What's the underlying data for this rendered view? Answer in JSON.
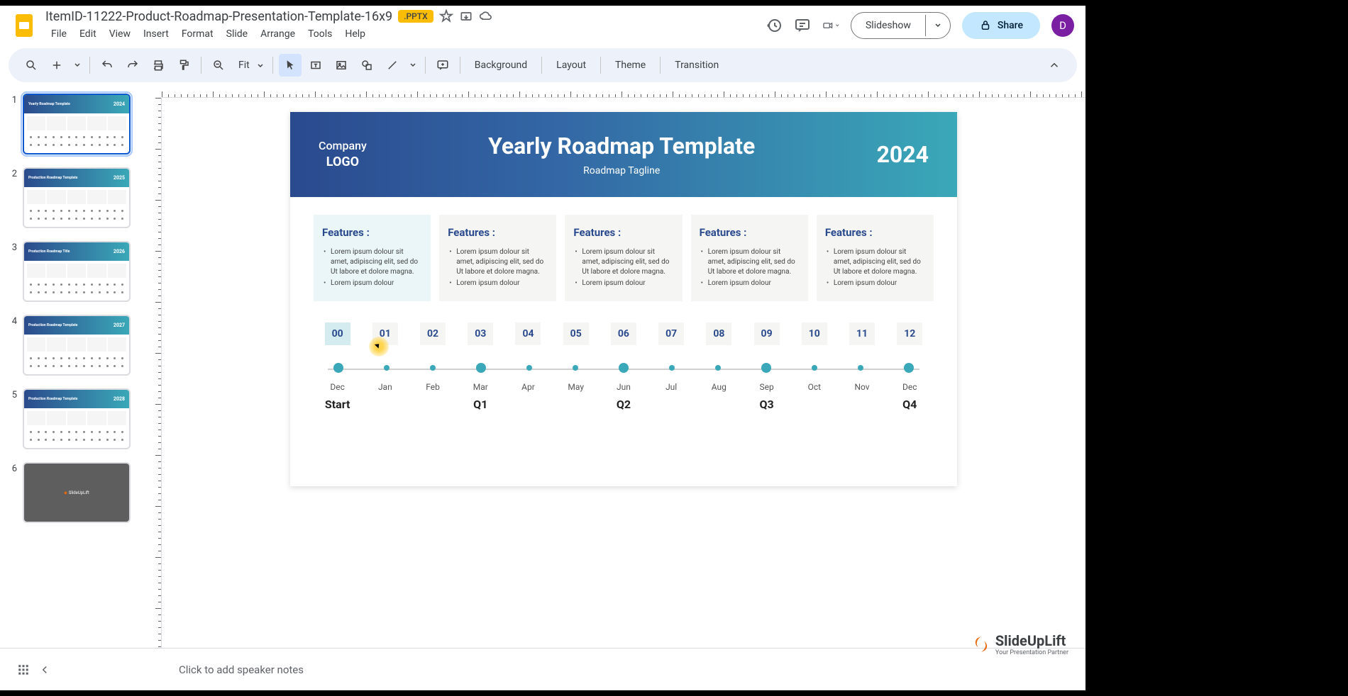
{
  "doc": {
    "title": "ItemID-11222-Product-Roadmap-Presentation-Template-16x9",
    "badge": ".PPTX"
  },
  "menus": [
    "File",
    "Edit",
    "View",
    "Insert",
    "Format",
    "Slide",
    "Arrange",
    "Tools",
    "Help"
  ],
  "toolbar": {
    "zoom": "Fit",
    "background": "Background",
    "layout": "Layout",
    "theme": "Theme",
    "transition": "Transition"
  },
  "header_actions": {
    "slideshow": "Slideshow",
    "share": "Share",
    "avatar": "D"
  },
  "thumbnails": [
    {
      "num": "1",
      "title": "Yearly Roadmap Template",
      "year": "2024",
      "selected": true
    },
    {
      "num": "2",
      "title": "Production Roadmap Template",
      "year": "2025",
      "selected": false
    },
    {
      "num": "3",
      "title": "Production Roadmap Title",
      "year": "2026",
      "selected": false
    },
    {
      "num": "4",
      "title": "Production Roadmap Template",
      "year": "2027",
      "selected": false
    },
    {
      "num": "5",
      "title": "Production Roadmap Template",
      "year": "2028",
      "selected": false
    },
    {
      "num": "6",
      "title": "SlideUpLift",
      "year": "",
      "selected": false,
      "dark": true
    }
  ],
  "slide": {
    "company_top": "Company",
    "company_bottom": "LOGO",
    "title": "Yearly Roadmap Template",
    "tagline": "Roadmap Tagline",
    "year": "2024",
    "feature_label": "Features :",
    "feature_items": [
      "Lorem ipsum dolour sit amet, adipiscing elit, sed do Ut labore et dolore magna.",
      "Lorem ipsum dolour"
    ],
    "numbers": [
      "00",
      "01",
      "02",
      "03",
      "04",
      "05",
      "06",
      "07",
      "08",
      "09",
      "10",
      "11",
      "12"
    ],
    "months": [
      "Dec",
      "Jan",
      "Feb",
      "Mar",
      "Apr",
      "May",
      "Jun",
      "Jul",
      "Aug",
      "Sep",
      "Oct",
      "Nov",
      "Dec"
    ],
    "quarters": [
      "Start",
      "",
      "",
      "Q1",
      "",
      "",
      "Q2",
      "",
      "",
      "Q3",
      "",
      "",
      "Q4"
    ],
    "big_dots": [
      0,
      3,
      6,
      9,
      12
    ]
  },
  "notes": {
    "placeholder": "Click to add speaker notes"
  },
  "watermark": {
    "main": "SlideUpLift",
    "sub": "Your Presentation Partner"
  }
}
